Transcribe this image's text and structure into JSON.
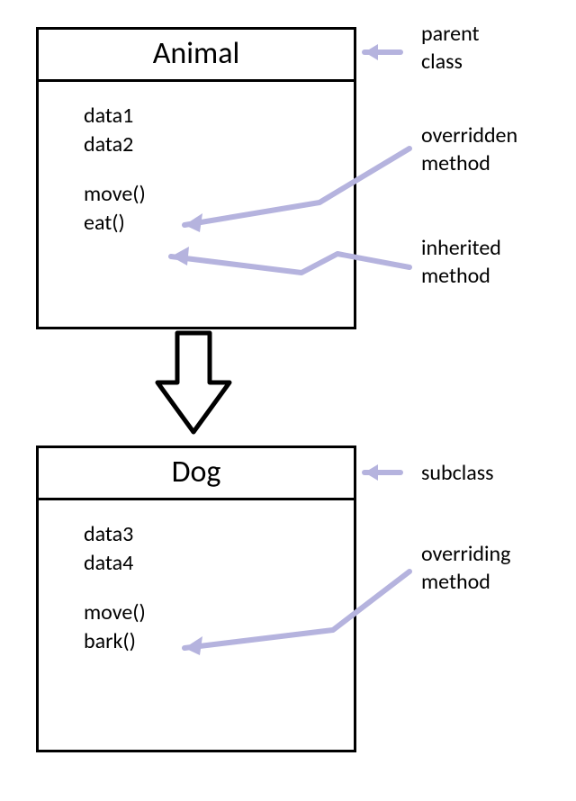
{
  "parent": {
    "name": "Animal",
    "data1": "data1",
    "data2": "data2",
    "method1": "move()",
    "method2": "eat()"
  },
  "child": {
    "name": "Dog",
    "data1": "data3",
    "data2": "data4",
    "method1": "move()",
    "method2": "bark()"
  },
  "labels": {
    "parent_class_l1": "parent",
    "parent_class_l2": "class",
    "overridden_l1": "overridden",
    "overridden_l2": "method",
    "inherited_l1": "inherited",
    "inherited_l2": "method",
    "subclass": "subclass",
    "overriding_l1": "overriding",
    "overriding_l2": "method"
  }
}
